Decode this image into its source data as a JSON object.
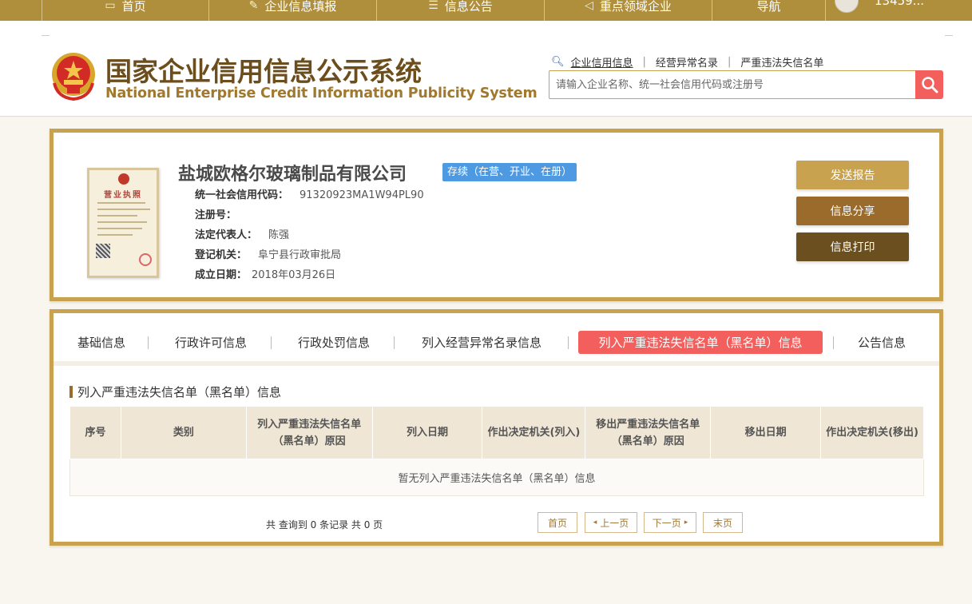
{
  "topnav": {
    "items": [
      {
        "label": "首页",
        "icon": "home-icon"
      },
      {
        "label": "企业信息填报",
        "icon": "edit-icon"
      },
      {
        "label": "信息公告",
        "icon": "document-icon"
      },
      {
        "label": "重点领域企业",
        "icon": "megaphone-icon"
      },
      {
        "label": "导航",
        "icon": ""
      }
    ],
    "username": "13459..."
  },
  "header": {
    "title_cn": "国家企业信用信息公示系统",
    "title_en": "National Enterprise Credit Information Publicity System",
    "quick_links": [
      "企业信用信息",
      "经营异常名录",
      "严重违法失信名单"
    ],
    "search_placeholder": "请输入企业名称、统一社会信用代码或注册号"
  },
  "company": {
    "name": "盐城欧格尔玻璃制品有限公司",
    "status": "存续（在营、开业、在册）",
    "license_title": "营业执照",
    "fields": [
      {
        "label": "统一社会信用代码：",
        "value": "91320923MA1W94PL90"
      },
      {
        "label": "注册号：",
        "value": ""
      },
      {
        "label": "法定代表人：",
        "value": "陈强"
      },
      {
        "label": "登记机关：",
        "value": "阜宁县行政审批局"
      },
      {
        "label": "成立日期：",
        "value": "2018年03月26日"
      }
    ],
    "actions": {
      "send": "发送报告",
      "share": "信息分享",
      "print": "信息打印"
    }
  },
  "tabs": [
    {
      "label": "基础信息",
      "active": false
    },
    {
      "label": "行政许可信息",
      "active": false
    },
    {
      "label": "行政处罚信息",
      "active": false
    },
    {
      "label": "列入经营异常名录信息",
      "active": false
    },
    {
      "label": "列入严重违法失信名单（黑名单）信息",
      "active": true
    },
    {
      "label": "公告信息",
      "active": false
    }
  ],
  "section": {
    "title": "列入严重违法失信名单（黑名单）信息",
    "columns": [
      "序号",
      "类别",
      "列入严重违法失信名单（黑名单）原因",
      "列入日期",
      "作出决定机关(列入)",
      "移出严重违法失信名单（黑名单）原因",
      "移出日期",
      "作出决定机关(移出)"
    ],
    "empty_text": "暂无列入严重违法失信名单（黑名单）信息"
  },
  "pagination": {
    "summary": "共 查询到 0 条记录 共 0 页",
    "first": "首页",
    "prev": "上一页",
    "next": "下一页",
    "last": "末页",
    "prev_arrow": "◂",
    "next_arrow": "▸"
  },
  "colors": {
    "gold": "#c9a24f",
    "nav": "#b08f3c",
    "active_tab": "#f25f5c",
    "status_badge": "#4d9ae3"
  }
}
